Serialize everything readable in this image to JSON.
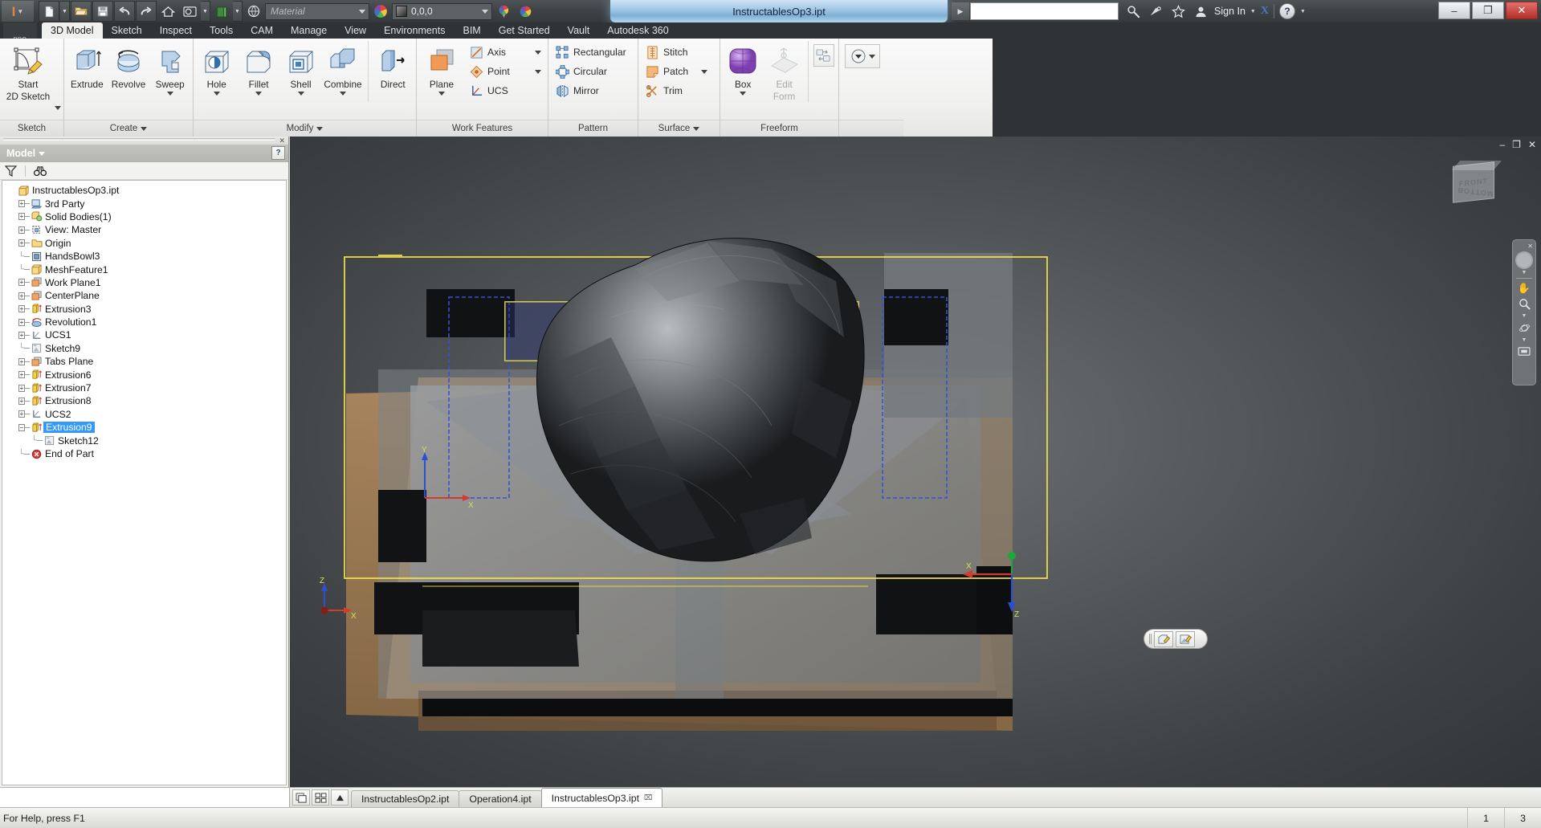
{
  "titlebar": {
    "document_title": "InstructablesOp3.ipt",
    "search_placeholder": "",
    "search_value": "",
    "sign_in_label": "Sign In",
    "material_placeholder": "Material",
    "appearance_value": "0,0,0",
    "window_buttons": {
      "minimize": "–",
      "restore": "❐",
      "close": "✕"
    },
    "help_label": "?",
    "exchange_label": "X"
  },
  "ribbon": {
    "pro_badge": "PRO",
    "tabs": [
      {
        "label": "3D Model",
        "active": true
      },
      {
        "label": "Sketch",
        "active": false
      },
      {
        "label": "Inspect",
        "active": false
      },
      {
        "label": "Tools",
        "active": false
      },
      {
        "label": "CAM",
        "active": false
      },
      {
        "label": "Manage",
        "active": false
      },
      {
        "label": "View",
        "active": false
      },
      {
        "label": "Environments",
        "active": false
      },
      {
        "label": "BIM",
        "active": false
      },
      {
        "label": "Get Started",
        "active": false
      },
      {
        "label": "Vault",
        "active": false
      },
      {
        "label": "Autodesk 360",
        "active": false
      }
    ],
    "panels": {
      "sketch": {
        "label": "Sketch",
        "start_2d_sketch": "Start\n2D Sketch",
        "start_line1": "Start",
        "start_line2": "2D Sketch"
      },
      "create": {
        "label": "Create",
        "extrude": "Extrude",
        "revolve": "Revolve",
        "sweep": "Sweep"
      },
      "modify": {
        "label": "Modify",
        "hole": "Hole",
        "fillet": "Fillet",
        "shell": "Shell",
        "combine": "Combine",
        "direct": "Direct"
      },
      "work_features": {
        "label": "Work Features",
        "plane": "Plane",
        "axis": "Axis",
        "point": "Point",
        "ucs": "UCS"
      },
      "pattern": {
        "label": "Pattern",
        "rectangular": "Rectangular",
        "circular": "Circular",
        "mirror": "Mirror"
      },
      "surface": {
        "label": "Surface",
        "stitch": "Stitch",
        "patch": "Patch",
        "trim": "Trim"
      },
      "freeform": {
        "label": "Freeform",
        "box": "Box",
        "edit_form_line1": "Edit",
        "edit_form_line2": "Form"
      }
    }
  },
  "browser": {
    "panel_title": "Model",
    "help_button": "?",
    "filter_icon": "filter-icon",
    "find_icon": "binoculars-icon",
    "tree": [
      {
        "label": "InstructablesOp3.ipt",
        "indent": 0,
        "expander": "none",
        "icon": "part-icon",
        "selected": false
      },
      {
        "label": "3rd Party",
        "indent": 1,
        "expander": "plus",
        "icon": "3rd-party-icon",
        "selected": false
      },
      {
        "label": "Solid Bodies(1)",
        "indent": 1,
        "expander": "plus",
        "icon": "solid-bodies-icon",
        "selected": false
      },
      {
        "label": "View: Master",
        "indent": 1,
        "expander": "plus",
        "icon": "view-icon",
        "selected": false
      },
      {
        "label": "Origin",
        "indent": 1,
        "expander": "plus",
        "icon": "folder-icon",
        "selected": false
      },
      {
        "label": "HandsBowl3",
        "indent": 1,
        "expander": "none",
        "icon": "mesh-icon",
        "selected": false
      },
      {
        "label": "MeshFeature1",
        "indent": 1,
        "expander": "none",
        "icon": "part-icon",
        "selected": false
      },
      {
        "label": "Work Plane1",
        "indent": 1,
        "expander": "plus",
        "icon": "workplane-icon",
        "selected": false
      },
      {
        "label": "CenterPlane",
        "indent": 1,
        "expander": "plus",
        "icon": "workplane-icon",
        "selected": false
      },
      {
        "label": "Extrusion3",
        "indent": 1,
        "expander": "plus",
        "icon": "extrusion-icon",
        "selected": false
      },
      {
        "label": "Revolution1",
        "indent": 1,
        "expander": "plus",
        "icon": "revolution-icon",
        "selected": false
      },
      {
        "label": "UCS1",
        "indent": 1,
        "expander": "plus",
        "icon": "ucs-icon",
        "selected": false
      },
      {
        "label": "Sketch9",
        "indent": 1,
        "expander": "none",
        "icon": "sketch-icon",
        "selected": false
      },
      {
        "label": "Tabs Plane",
        "indent": 1,
        "expander": "plus",
        "icon": "workplane-icon",
        "selected": false
      },
      {
        "label": "Extrusion6",
        "indent": 1,
        "expander": "plus",
        "icon": "extrusion-icon",
        "selected": false
      },
      {
        "label": "Extrusion7",
        "indent": 1,
        "expander": "plus",
        "icon": "extrusion-icon",
        "selected": false
      },
      {
        "label": "Extrusion8",
        "indent": 1,
        "expander": "plus",
        "icon": "extrusion-icon",
        "selected": false
      },
      {
        "label": "UCS2",
        "indent": 1,
        "expander": "plus",
        "icon": "ucs-icon",
        "selected": false
      },
      {
        "label": "Extrusion9",
        "indent": 1,
        "expander": "minus",
        "icon": "extrusion-icon",
        "selected": true
      },
      {
        "label": "Sketch12",
        "indent": 2,
        "expander": "none",
        "icon": "sketch-icon",
        "selected": false
      },
      {
        "label": "End of Part",
        "indent": 1,
        "expander": "none",
        "icon": "end-of-part-icon",
        "selected": false
      }
    ]
  },
  "viewport": {
    "viewcube_front": "FRONT",
    "viewcube_bottom": "BOTTOM",
    "navbar_items": [
      "close-icon",
      "full-navigation-wheel-icon",
      "pan-icon",
      "zoom-icon",
      "orbit-icon",
      "look-at-icon"
    ],
    "axis_labels": {
      "y": "Y",
      "x": "X",
      "z": "Z"
    },
    "mini_toolbar": [
      "edit-extrude-icon",
      "edit-sketch-icon"
    ],
    "window_controls": {
      "minimize": "–",
      "restore": "❐",
      "close": "✕"
    }
  },
  "document_tabs": {
    "tabs": [
      {
        "label": "InstructablesOp2.ipt",
        "active": false,
        "closable": false
      },
      {
        "label": "Operation4.ipt",
        "active": false,
        "closable": false
      },
      {
        "label": "InstructablesOp3.ipt",
        "active": true,
        "closable": true
      }
    ],
    "close_glyph": "⌧",
    "icons": [
      "cascade-windows-icon",
      "tile-windows-icon",
      "scroll-up-icon"
    ]
  },
  "statusbar": {
    "message": "For Help, press F1",
    "cell_1": "1",
    "cell_2": "3"
  },
  "colors": {
    "accent_orange": "#e8813a",
    "selection_blue": "#3399ff",
    "ribbon_bg": "#f0f0ef",
    "titlebar_dark": "#3f4447",
    "viewport_bg": "#55585b",
    "sketch_yellow": "#f2e14a",
    "freeform_purple": "#9b59d0"
  }
}
